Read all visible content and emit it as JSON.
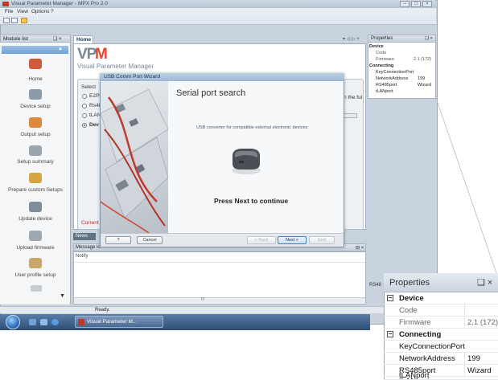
{
  "window": {
    "title": "Visual Parameter Manager - MPX Pro 2.0",
    "menu": [
      "File",
      "View",
      "Options",
      "?"
    ]
  },
  "module_list": {
    "title": "Module list",
    "pin": "❑ ×",
    "items": [
      {
        "label": "Home",
        "icon": "home-icon"
      },
      {
        "label": "Device setup",
        "icon": "device-setup-icon"
      },
      {
        "label": "Output setup",
        "icon": "output-setup-icon"
      },
      {
        "label": "Setup summary",
        "icon": "setup-summary-icon"
      },
      {
        "label": "Prepare custom Setups",
        "icon": "custom-setups-icon"
      },
      {
        "label": "Update device",
        "icon": "update-device-icon"
      },
      {
        "label": "Upload firmware",
        "icon": "upload-firmware-icon"
      },
      {
        "label": "User profile setup",
        "icon": "user-profile-icon"
      }
    ]
  },
  "home": {
    "tab": "Home",
    "logo_v": "VP",
    "logo_m": "M",
    "logo_sub": "Visual Parameter Manager",
    "select_label": "Select",
    "options": [
      "E2PR",
      "Rs48",
      "tLAN",
      "Dev"
    ],
    "selected_option": 3,
    "right_text": "n the ful",
    "current_label": "Current"
  },
  "news_tab": "News",
  "message_log": {
    "title": "Message lo",
    "column": "Notify",
    "scroll_mark": "III"
  },
  "properties": {
    "title": "Properties",
    "pin": "❑ ×",
    "groups": [
      {
        "name": "Device",
        "rows": [
          {
            "key": "Code",
            "value": ""
          },
          {
            "key": "Firmware",
            "value": "2.1 (172)"
          }
        ]
      },
      {
        "name": "Connecting",
        "rows": [
          {
            "key": "KeyConnectionPort",
            "value": ""
          },
          {
            "key": "NetworkAddress",
            "value": "199"
          },
          {
            "key": "RS485port",
            "value": "Wizard"
          },
          {
            "key": "tLANport",
            "value": ""
          }
        ]
      }
    ],
    "expander": "−"
  },
  "rs_fragment": "RS48",
  "status": {
    "text": "Ready."
  },
  "taskbar": {
    "app_label": "Visual Parameter M..."
  },
  "dialog": {
    "title": "USB Comm Port Wizard",
    "heading": "Serial port search",
    "description": "USB converter for compatible external electronic devices:",
    "cta": "Press Next to continue",
    "buttons": {
      "help": "?",
      "cancel": "Cancel",
      "back": "< Back",
      "next": "Next >",
      "end": "End"
    }
  },
  "colors": {
    "accent": "#e8442e",
    "selection": "#6f9fd2",
    "taskbar": "#2d4c74"
  }
}
